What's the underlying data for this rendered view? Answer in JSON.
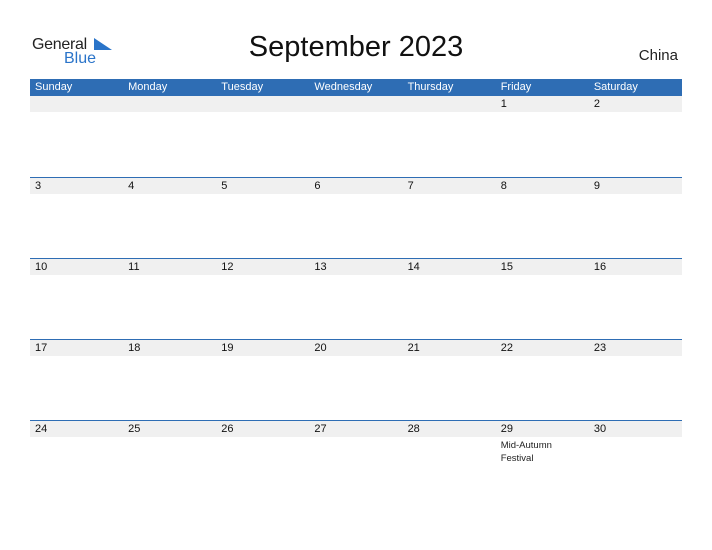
{
  "logo": {
    "general": "General",
    "blue": "Blue"
  },
  "title": "September 2023",
  "country": "China",
  "weekdays": [
    "Sunday",
    "Monday",
    "Tuesday",
    "Wednesday",
    "Thursday",
    "Friday",
    "Saturday"
  ],
  "weeks": [
    [
      {
        "d": ""
      },
      {
        "d": ""
      },
      {
        "d": ""
      },
      {
        "d": ""
      },
      {
        "d": ""
      },
      {
        "d": "1"
      },
      {
        "d": "2"
      }
    ],
    [
      {
        "d": "3"
      },
      {
        "d": "4"
      },
      {
        "d": "5"
      },
      {
        "d": "6"
      },
      {
        "d": "7"
      },
      {
        "d": "8"
      },
      {
        "d": "9"
      }
    ],
    [
      {
        "d": "10"
      },
      {
        "d": "11"
      },
      {
        "d": "12"
      },
      {
        "d": "13"
      },
      {
        "d": "14"
      },
      {
        "d": "15"
      },
      {
        "d": "16"
      }
    ],
    [
      {
        "d": "17"
      },
      {
        "d": "18"
      },
      {
        "d": "19"
      },
      {
        "d": "20"
      },
      {
        "d": "21"
      },
      {
        "d": "22"
      },
      {
        "d": "23"
      }
    ],
    [
      {
        "d": "24"
      },
      {
        "d": "25"
      },
      {
        "d": "26"
      },
      {
        "d": "27"
      },
      {
        "d": "28"
      },
      {
        "d": "29",
        "event": "Mid-Autumn Festival"
      },
      {
        "d": "30"
      }
    ]
  ],
  "colors": {
    "header": "#2e6db4",
    "brand_blue": "#2a74c9",
    "date_strip": "#f0f0f0"
  }
}
